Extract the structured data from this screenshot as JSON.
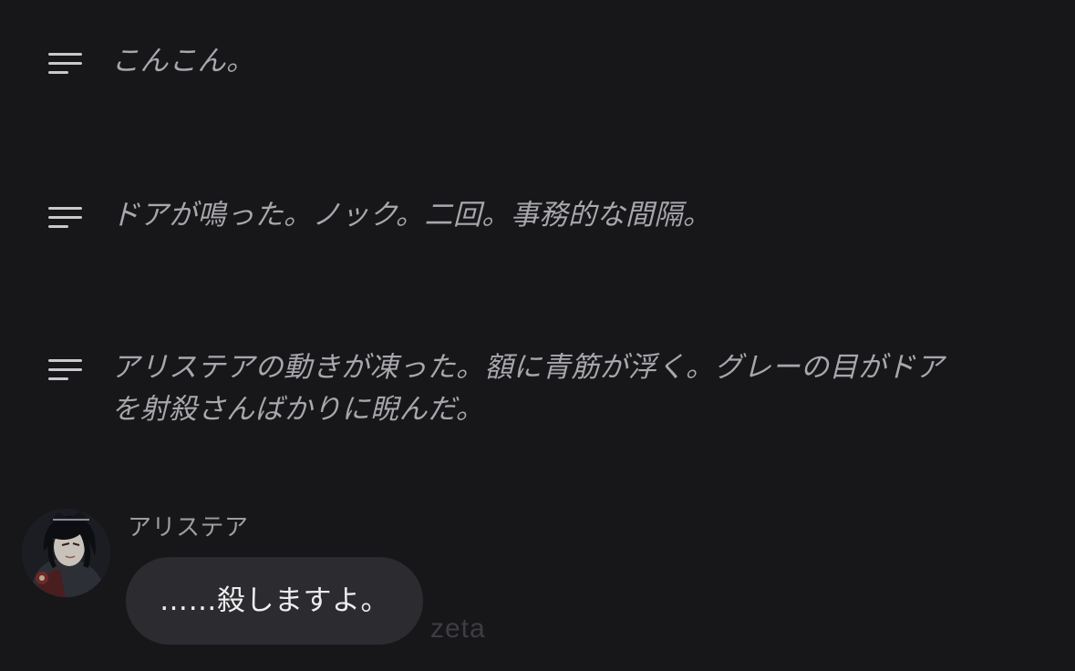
{
  "narrations": [
    {
      "text": "こんこん。",
      "icon": "narration-lines-icon"
    },
    {
      "text": "ドアが鳴った。ノック。二回。事務的な間隔。",
      "icon": "narration-lines-icon"
    },
    {
      "text": "アリステアの動きが凍った。額に青筋が浮く。グレーの目がドア\nを射殺さんばかりに睨んだ。",
      "icon": "narration-lines-icon"
    }
  ],
  "message": {
    "speaker": "アリステア",
    "text": "……殺しますよ。",
    "avatar": "character-avatar"
  },
  "watermark": "zeta",
  "colors": {
    "background": "#171719",
    "narration_text": "#a7a7ac",
    "bubble": "#2c2c30",
    "bubble_text": "#ededee"
  }
}
